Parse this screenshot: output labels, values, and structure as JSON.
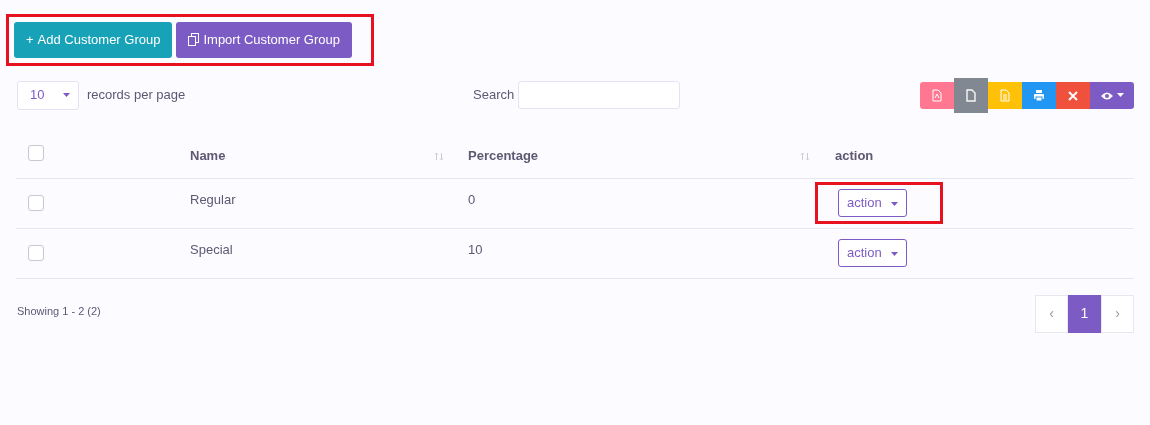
{
  "toolbar": {
    "highlighted": true,
    "buttons": [
      {
        "kind": "add",
        "label": "Add Customer Group",
        "icon": "+"
      },
      {
        "kind": "import",
        "label": "Import Customer Group"
      }
    ]
  },
  "page_size": {
    "value": "10",
    "label": "records per page"
  },
  "search": {
    "label": "Search"
  },
  "export_buttons": [
    {
      "kind": "pdf",
      "color": "#ff7790",
      "selected": false
    },
    {
      "kind": "csv",
      "color": "#858c96",
      "selected": true
    },
    {
      "kind": "excel",
      "color": "#ffc107",
      "selected": false
    },
    {
      "kind": "print",
      "color": "#2196f3",
      "selected": false
    },
    {
      "kind": "delete",
      "color": "#f0513c",
      "selected": false
    },
    {
      "kind": "visibility",
      "color": "#7c5cc4",
      "selected": false
    }
  ],
  "table": {
    "select_all": {
      "checked": false
    },
    "columns": [
      {
        "label": "Name",
        "sortable": true
      },
      {
        "label": "Percentage",
        "sortable": true
      },
      {
        "label": "action",
        "sortable": false
      }
    ],
    "rows": [
      {
        "checked": false,
        "name": "Regular",
        "percentage": "0",
        "action": "action",
        "highlighted": true
      },
      {
        "checked": false,
        "name": "Special",
        "percentage": "10",
        "action": "action",
        "highlighted": false
      }
    ]
  },
  "footer": {
    "info": "Showing 1 - 2 (2)"
  },
  "pagination": [
    {
      "label": "‹",
      "selected": false
    },
    {
      "label": "1",
      "selected": true
    },
    {
      "label": "›",
      "selected": false
    }
  ]
}
